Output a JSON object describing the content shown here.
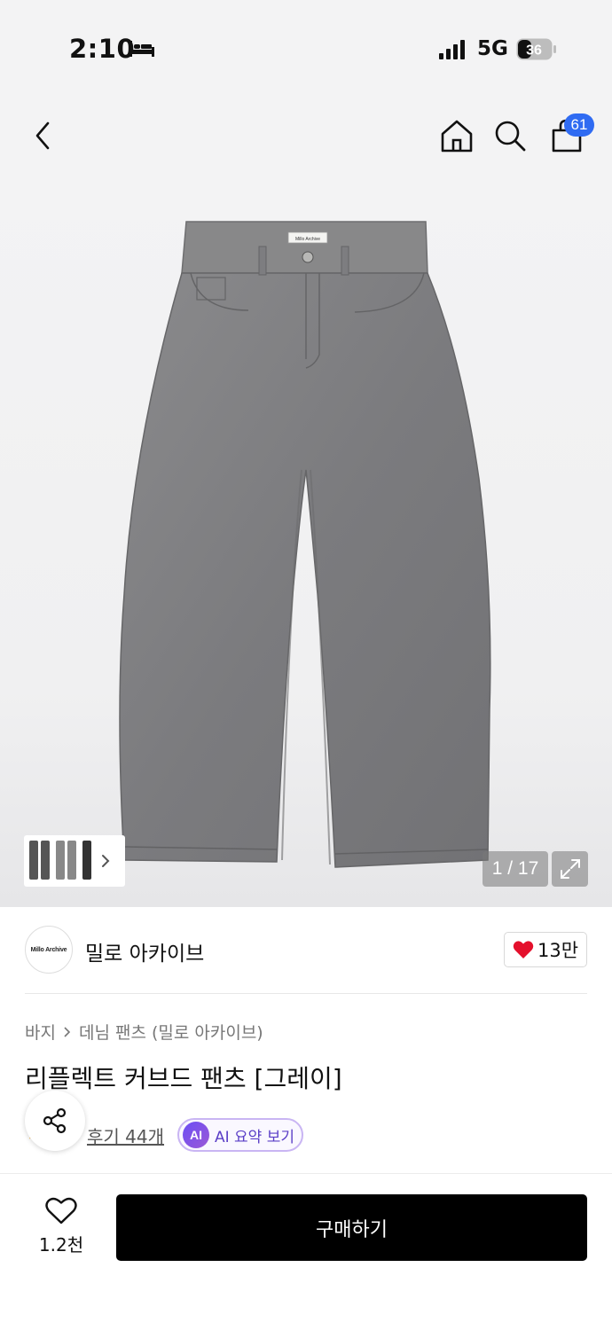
{
  "status_bar": {
    "time": "2:10",
    "network": "5G",
    "battery": "36",
    "icons": [
      "bed-icon",
      "signal-icon",
      "battery-icon"
    ]
  },
  "top_nav": {
    "icons": [
      "back-arrow-icon",
      "home-icon",
      "search-icon",
      "shopping-bag-icon"
    ],
    "cart_count": "61",
    "accent_color": "#2f6bf2"
  },
  "gallery": {
    "page_indicator": "1 / 17",
    "thumbnail_icon": "chevron-right-icon",
    "expand_icon": "expand-icon",
    "brand_label_on_image": "Millo Archive"
  },
  "brand": {
    "logo_text": "Millo Archive",
    "name": "밀로 아카이브",
    "like_count": "13만",
    "like_color": "#e4102c"
  },
  "breadcrumb": {
    "category": "바지",
    "separator": ">",
    "subcategory": "데님 팬츠 (밀로 아카이브)"
  },
  "product": {
    "title": "리플렉트 커브드 팬츠 [그레이]",
    "review_label": "후기 44개",
    "ai_badge": "AI",
    "ai_label": "AI 요약 보기"
  },
  "bottom_bar": {
    "wish_count": "1.2천",
    "buy_label": "구매하기"
  }
}
